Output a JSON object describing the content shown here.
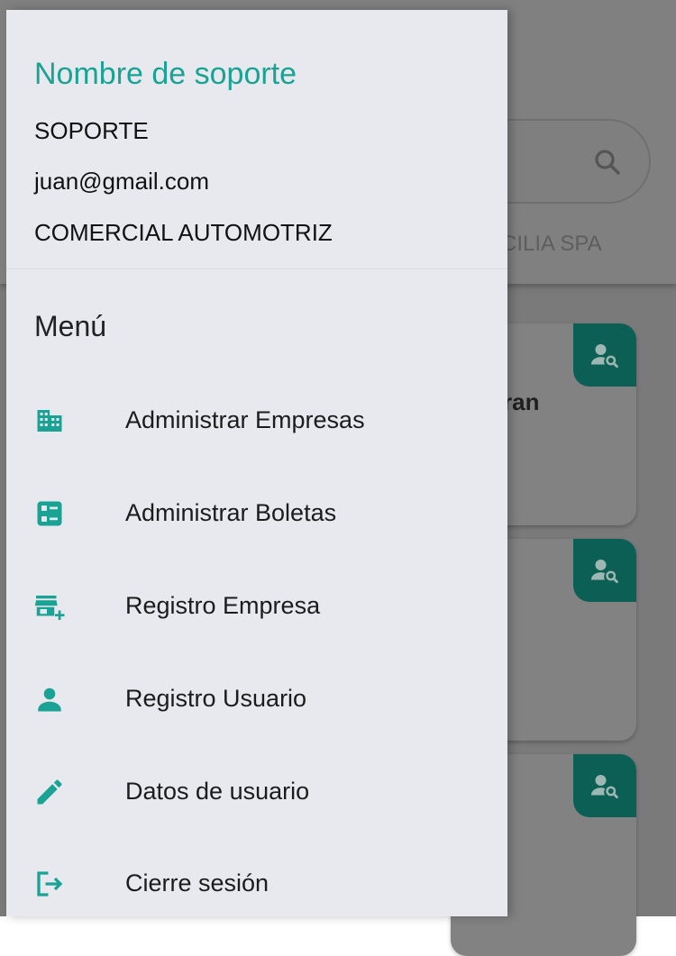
{
  "colors": {
    "accent": "#1aa394",
    "drawer_background": "#e7e9ee",
    "scrim": "#7a7a7a",
    "badge": "#0c5f54"
  },
  "drawer": {
    "support_name": "Nombre de soporte",
    "role": "SOPORTE",
    "email": "juan@gmail.com",
    "company": "COMERCIAL AUTOMOTRIZ",
    "menu_title": "Menú",
    "items": [
      {
        "label": "Administrar Empresas",
        "icon": "building-icon"
      },
      {
        "label": "Administrar Boletas",
        "icon": "receipt-list-icon"
      },
      {
        "label": "Registro Empresa",
        "icon": "add-store-icon"
      },
      {
        "label": "Registro Usuario",
        "icon": "person-icon"
      },
      {
        "label": "Datos de usuario",
        "icon": "pencil-icon"
      },
      {
        "label": "Cierre sesión",
        "icon": "logout-icon"
      }
    ]
  },
  "background": {
    "company_fragment": "ECILIA SPA",
    "card_fragment": "ran",
    "card_icon": "person-search-icon"
  }
}
